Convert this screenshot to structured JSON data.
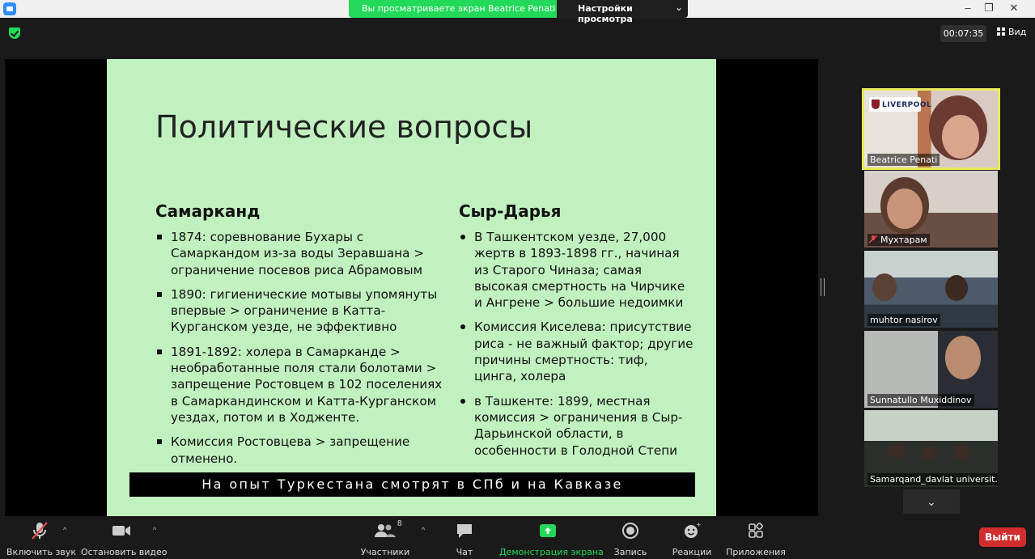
{
  "titlebar": {
    "share_banner_text": "Вы просматриваете экран Beatrice Penati",
    "view_options_label": "Настройки просмотра",
    "minimize": "–",
    "maximize": "❐",
    "close": "✕"
  },
  "top": {
    "timer": "00:07:35",
    "view_label": "Вид"
  },
  "slide": {
    "title": "Политические вопросы",
    "left_heading": "Самарканд",
    "left_bullets": [
      "1874: соревнование Бухары с Самаркандом из-за воды Зеравшана > ограничение посевов риса Абрамовым",
      "1890: гигиенические мотывы упомянуты впервые > ограничение в Катта-Курганском уезде, не эффективно",
      "1891-1892: холера в Самарканде > необработанные поля стали болотами > запрещение Ростовцем в 102 поселениях в Самаркандинском и Катта-Курганском уездах, потом и в Ходженте.",
      "Комиссия Ростовцева > запрещение отменено."
    ],
    "right_heading": "Сыр-Дарья",
    "right_bullets": [
      "В Ташкентском уезде, 27,000 жертв в 1893-1898 гг., начиная из Старого Чиназа; самая высокая смертность на Чирчике и Ангрене > большие недоимки",
      "Комиссия Киселева: присутствие риса - не важный фактор; другие причины смертность: тиф, цинга, холера",
      "в Ташкенте: 1899, местная комиссия > ограничения в Сыр-Дарьинской области, в особенности в Голодной Степи"
    ],
    "banner": "На опыт Туркестана смотрят в СПб и на Кавказе"
  },
  "participants": [
    {
      "name": "Beatrice Penati",
      "logo_text": "LIVERPOOL"
    },
    {
      "name": "Мухтарам"
    },
    {
      "name": "muhtor nasirov"
    },
    {
      "name": "Sunnatullo Muxiddinov"
    },
    {
      "name": "Samarqand_davlat universit..."
    }
  ],
  "participants_more": "⌄",
  "toolbar": {
    "unmute": "Включить звук",
    "stop_video": "Остановить видео",
    "participants": "Участники",
    "participants_count": "8",
    "chat": "Чат",
    "share_screen": "Демонстрация экрана",
    "record": "Запись",
    "reactions": "Реакции",
    "apps": "Приложения",
    "leave": "Выйти",
    "caret": "^"
  }
}
